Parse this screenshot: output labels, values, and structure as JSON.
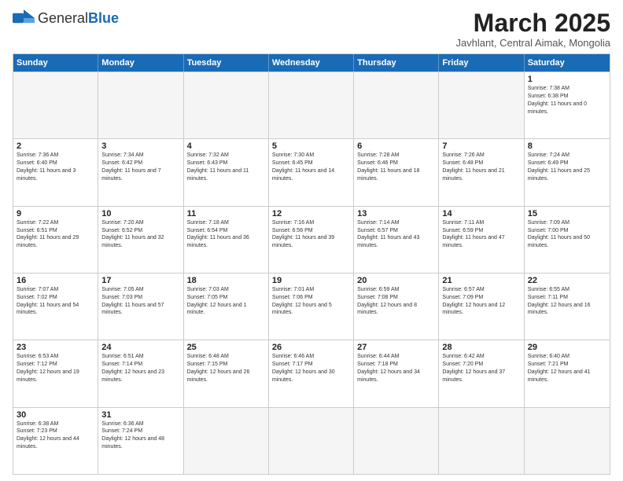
{
  "logo": {
    "general": "General",
    "blue": "Blue"
  },
  "header": {
    "title": "March 2025",
    "subtitle": "Javhlant, Central Aimak, Mongolia"
  },
  "days": [
    "Sunday",
    "Monday",
    "Tuesday",
    "Wednesday",
    "Thursday",
    "Friday",
    "Saturday"
  ],
  "rows": [
    [
      {
        "day": "",
        "info": "",
        "empty": true
      },
      {
        "day": "",
        "info": "",
        "empty": true
      },
      {
        "day": "",
        "info": "",
        "empty": true
      },
      {
        "day": "",
        "info": "",
        "empty": true
      },
      {
        "day": "",
        "info": "",
        "empty": true
      },
      {
        "day": "",
        "info": "",
        "empty": true
      },
      {
        "day": "1",
        "info": "Sunrise: 7:38 AM\nSunset: 6:38 PM\nDaylight: 11 hours and 0 minutes.",
        "empty": false
      }
    ],
    [
      {
        "day": "2",
        "info": "Sunrise: 7:36 AM\nSunset: 6:40 PM\nDaylight: 11 hours and 3 minutes.",
        "empty": false
      },
      {
        "day": "3",
        "info": "Sunrise: 7:34 AM\nSunset: 6:42 PM\nDaylight: 11 hours and 7 minutes.",
        "empty": false
      },
      {
        "day": "4",
        "info": "Sunrise: 7:32 AM\nSunset: 6:43 PM\nDaylight: 11 hours and 11 minutes.",
        "empty": false
      },
      {
        "day": "5",
        "info": "Sunrise: 7:30 AM\nSunset: 6:45 PM\nDaylight: 11 hours and 14 minutes.",
        "empty": false
      },
      {
        "day": "6",
        "info": "Sunrise: 7:28 AM\nSunset: 6:46 PM\nDaylight: 11 hours and 18 minutes.",
        "empty": false
      },
      {
        "day": "7",
        "info": "Sunrise: 7:26 AM\nSunset: 6:48 PM\nDaylight: 11 hours and 21 minutes.",
        "empty": false
      },
      {
        "day": "8",
        "info": "Sunrise: 7:24 AM\nSunset: 6:49 PM\nDaylight: 11 hours and 25 minutes.",
        "empty": false
      }
    ],
    [
      {
        "day": "9",
        "info": "Sunrise: 7:22 AM\nSunset: 6:51 PM\nDaylight: 11 hours and 29 minutes.",
        "empty": false
      },
      {
        "day": "10",
        "info": "Sunrise: 7:20 AM\nSunset: 6:52 PM\nDaylight: 11 hours and 32 minutes.",
        "empty": false
      },
      {
        "day": "11",
        "info": "Sunrise: 7:18 AM\nSunset: 6:54 PM\nDaylight: 11 hours and 36 minutes.",
        "empty": false
      },
      {
        "day": "12",
        "info": "Sunrise: 7:16 AM\nSunset: 6:56 PM\nDaylight: 11 hours and 39 minutes.",
        "empty": false
      },
      {
        "day": "13",
        "info": "Sunrise: 7:14 AM\nSunset: 6:57 PM\nDaylight: 11 hours and 43 minutes.",
        "empty": false
      },
      {
        "day": "14",
        "info": "Sunrise: 7:11 AM\nSunset: 6:59 PM\nDaylight: 11 hours and 47 minutes.",
        "empty": false
      },
      {
        "day": "15",
        "info": "Sunrise: 7:09 AM\nSunset: 7:00 PM\nDaylight: 11 hours and 50 minutes.",
        "empty": false
      }
    ],
    [
      {
        "day": "16",
        "info": "Sunrise: 7:07 AM\nSunset: 7:02 PM\nDaylight: 11 hours and 54 minutes.",
        "empty": false
      },
      {
        "day": "17",
        "info": "Sunrise: 7:05 AM\nSunset: 7:03 PM\nDaylight: 11 hours and 57 minutes.",
        "empty": false
      },
      {
        "day": "18",
        "info": "Sunrise: 7:03 AM\nSunset: 7:05 PM\nDaylight: 12 hours and 1 minute.",
        "empty": false
      },
      {
        "day": "19",
        "info": "Sunrise: 7:01 AM\nSunset: 7:06 PM\nDaylight: 12 hours and 5 minutes.",
        "empty": false
      },
      {
        "day": "20",
        "info": "Sunrise: 6:59 AM\nSunset: 7:08 PM\nDaylight: 12 hours and 8 minutes.",
        "empty": false
      },
      {
        "day": "21",
        "info": "Sunrise: 6:57 AM\nSunset: 7:09 PM\nDaylight: 12 hours and 12 minutes.",
        "empty": false
      },
      {
        "day": "22",
        "info": "Sunrise: 6:55 AM\nSunset: 7:11 PM\nDaylight: 12 hours and 16 minutes.",
        "empty": false
      }
    ],
    [
      {
        "day": "23",
        "info": "Sunrise: 6:53 AM\nSunset: 7:12 PM\nDaylight: 12 hours and 19 minutes.",
        "empty": false
      },
      {
        "day": "24",
        "info": "Sunrise: 6:51 AM\nSunset: 7:14 PM\nDaylight: 12 hours and 23 minutes.",
        "empty": false
      },
      {
        "day": "25",
        "info": "Sunrise: 6:48 AM\nSunset: 7:15 PM\nDaylight: 12 hours and 26 minutes.",
        "empty": false
      },
      {
        "day": "26",
        "info": "Sunrise: 6:46 AM\nSunset: 7:17 PM\nDaylight: 12 hours and 30 minutes.",
        "empty": false
      },
      {
        "day": "27",
        "info": "Sunrise: 6:44 AM\nSunset: 7:18 PM\nDaylight: 12 hours and 34 minutes.",
        "empty": false
      },
      {
        "day": "28",
        "info": "Sunrise: 6:42 AM\nSunset: 7:20 PM\nDaylight: 12 hours and 37 minutes.",
        "empty": false
      },
      {
        "day": "29",
        "info": "Sunrise: 6:40 AM\nSunset: 7:21 PM\nDaylight: 12 hours and 41 minutes.",
        "empty": false
      }
    ],
    [
      {
        "day": "30",
        "info": "Sunrise: 6:38 AM\nSunset: 7:23 PM\nDaylight: 12 hours and 44 minutes.",
        "empty": false
      },
      {
        "day": "31",
        "info": "Sunrise: 6:36 AM\nSunset: 7:24 PM\nDaylight: 12 hours and 48 minutes.",
        "empty": false
      },
      {
        "day": "",
        "info": "",
        "empty": true
      },
      {
        "day": "",
        "info": "",
        "empty": true
      },
      {
        "day": "",
        "info": "",
        "empty": true
      },
      {
        "day": "",
        "info": "",
        "empty": true
      },
      {
        "day": "",
        "info": "",
        "empty": true
      }
    ]
  ]
}
